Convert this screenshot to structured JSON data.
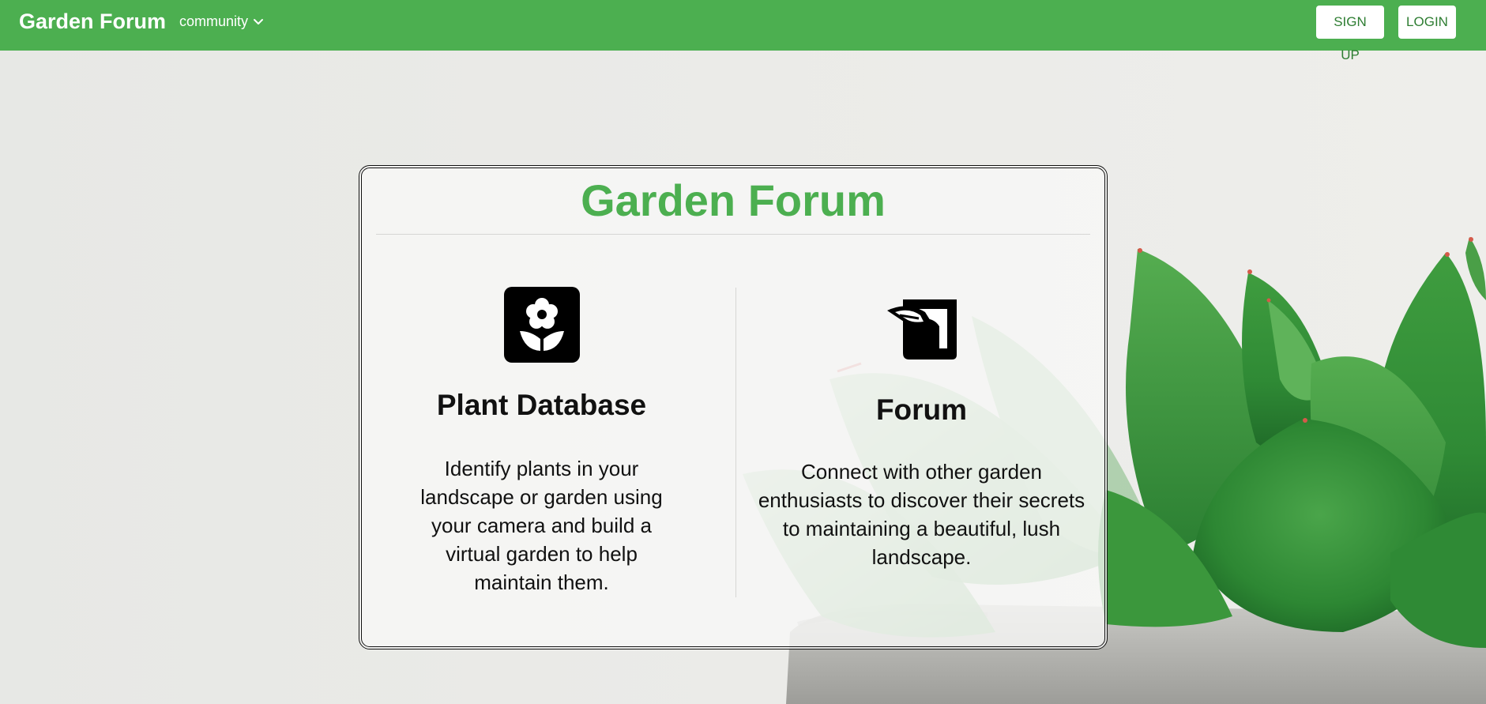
{
  "navbar": {
    "brand": "Garden Forum",
    "community_label": "community",
    "signup_label": "SIGN UP",
    "login_label": "LOGIN",
    "background_color": "#4caf50"
  },
  "card": {
    "title": "Garden Forum",
    "title_color": "#4caf50",
    "features": [
      {
        "icon": "flower-icon",
        "title": "Plant Database",
        "description": "Identify plants in your landscape or garden using your camera and build a virtual garden to help maintain them."
      },
      {
        "icon": "forum-icon",
        "title": "Forum",
        "description": "Connect with other garden enthusiasts to discover their secrets to maintaining a beautiful, lush landscape."
      }
    ]
  },
  "background": {
    "image": "succulent-plant-in-concrete-pot"
  }
}
